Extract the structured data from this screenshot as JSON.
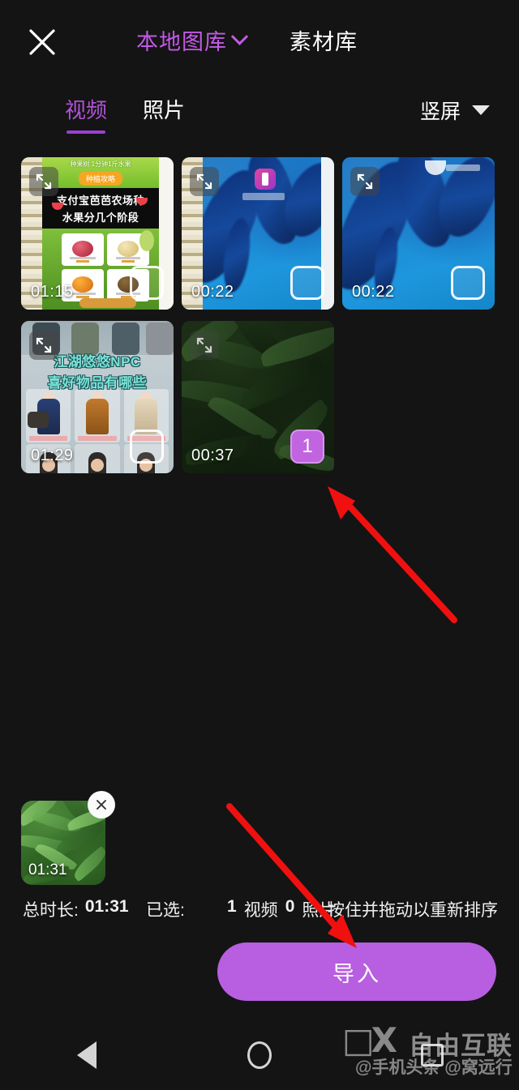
{
  "app": {
    "background": "#141414",
    "accent": "#b85ee0",
    "accent_text": "#c25ae6"
  },
  "header": {
    "close_icon": "close-icon",
    "tabs": [
      {
        "label": "本地图库",
        "active": true,
        "has_chevron": true
      },
      {
        "label": "素材库",
        "active": false,
        "has_chevron": false
      }
    ]
  },
  "subheader": {
    "tabs": [
      {
        "label": "视频",
        "active": true
      },
      {
        "label": "照片",
        "active": false
      }
    ],
    "orientation_filter": {
      "label": "竖屏",
      "icon": "caret-down-icon"
    }
  },
  "grid": {
    "items": [
      {
        "art": "notebook-farm",
        "duration": "01:15",
        "selected": false,
        "badge": "",
        "expand_icon": "expand-icon",
        "overlay_title_line1": "支付宝芭芭农场种",
        "overlay_title_line2": "水果分几个阶段",
        "overlay_banner_top": "种果树 1分钟1斤水果",
        "overlay_banner_chip": "种植攻略"
      },
      {
        "art": "blue-wallpaper",
        "duration": "00:22",
        "selected": false,
        "badge": "",
        "expand_icon": "expand-icon",
        "overlay_title_line1": "",
        "overlay_title_line2": "",
        "overlay_banner_top": "",
        "overlay_banner_chip": ""
      },
      {
        "art": "blue-wallpaper-2",
        "duration": "00:22",
        "selected": false,
        "badge": "",
        "expand_icon": "expand-icon",
        "overlay_title_line1": "",
        "overlay_title_line2": "",
        "overlay_banner_top": "",
        "overlay_banner_chip": ""
      },
      {
        "art": "game-characters",
        "duration": "01:29",
        "selected": false,
        "badge": "",
        "expand_icon": "expand-icon",
        "overlay_title_line1": "江湖悠悠NPC",
        "overlay_title_line2": "喜好物品有哪些",
        "overlay_banner_top": "",
        "overlay_banner_chip": ""
      },
      {
        "art": "green-leaves",
        "duration": "00:37",
        "selected": true,
        "badge": "1",
        "expand_icon": "expand-icon",
        "overlay_title_line1": "",
        "overlay_title_line2": "",
        "overlay_banner_top": "",
        "overlay_banner_chip": ""
      }
    ]
  },
  "selected_strip": {
    "items": [
      {
        "art": "green-leaves",
        "duration": "01:31",
        "remove_icon": "close-icon"
      }
    ]
  },
  "status": {
    "total_label": "总时长:",
    "total_value": "01:31",
    "selected_label": "已选:",
    "video_count": "1",
    "video_unit": "视频",
    "photo_count": "0",
    "photo_unit": "照片",
    "reorder_hint": "按住并拖动以重新排序"
  },
  "import_button": {
    "label": "导入"
  },
  "navbar": {
    "items": [
      {
        "icon": "back-triangle-icon"
      },
      {
        "icon": "home-circle-icon"
      },
      {
        "icon": "recents-square-icon"
      }
    ]
  },
  "watermark": {
    "logo_glyph": "□X",
    "brand": "自由互联",
    "handle": "@手机头条 @窝远行"
  },
  "annotations": {
    "arrows": [
      {
        "name": "arrow-to-selected-thumb",
        "color": "#f01010"
      },
      {
        "name": "arrow-to-import-button",
        "color": "#f01010"
      }
    ]
  }
}
